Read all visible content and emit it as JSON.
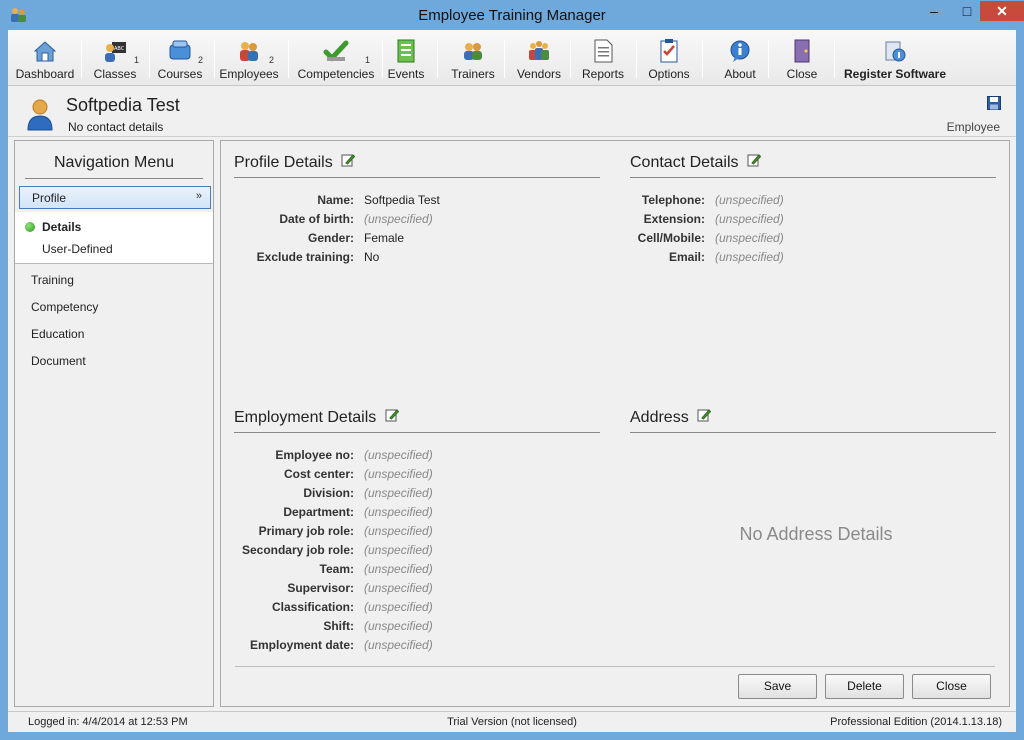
{
  "window": {
    "title": "Employee Training Manager",
    "minimize": "–",
    "maximize": "□",
    "close": "✕"
  },
  "toolbar": {
    "items": [
      {
        "label": "Dashboard",
        "count": "",
        "icon": "dashboard-icon"
      },
      {
        "label": "Classes",
        "count": "1",
        "icon": "classes-icon"
      },
      {
        "label": "Courses",
        "count": "2",
        "icon": "courses-icon"
      },
      {
        "label": "Employees",
        "count": "2",
        "icon": "employees-icon"
      },
      {
        "label": "Competencies",
        "count": "1",
        "icon": "competencies-icon"
      },
      {
        "label": "Events",
        "count": "",
        "icon": "events-icon"
      },
      {
        "label": "Trainers",
        "count": "",
        "icon": "trainers-icon"
      },
      {
        "label": "Vendors",
        "count": "",
        "icon": "vendors-icon"
      },
      {
        "label": "Reports",
        "count": "",
        "icon": "reports-icon"
      },
      {
        "label": "Options",
        "count": "",
        "icon": "options-icon"
      },
      {
        "label": "About",
        "count": "",
        "icon": "about-icon"
      },
      {
        "label": "Close",
        "count": "",
        "icon": "close-door-icon"
      },
      {
        "label": "Register Software",
        "count": "",
        "icon": "register-icon"
      }
    ]
  },
  "header": {
    "name": "Softpedia Test",
    "contact": "No contact details",
    "type": "Employee"
  },
  "nav": {
    "title": "Navigation Menu",
    "profile": "Profile",
    "chevron": "»",
    "details": "Details",
    "user_defined": "User-Defined",
    "items": [
      "Training",
      "Competency",
      "Education",
      "Document"
    ]
  },
  "profile": {
    "title": "Profile Details",
    "fields": [
      {
        "label": "Name:",
        "value": "Softpedia Test"
      },
      {
        "label": "Date of birth:",
        "value": "(unspecified)"
      },
      {
        "label": "Gender:",
        "value": "Female"
      },
      {
        "label": "Exclude training:",
        "value": "No"
      }
    ]
  },
  "contact": {
    "title": "Contact Details",
    "fields": [
      {
        "label": "Telephone:",
        "value": "(unspecified)"
      },
      {
        "label": "Extension:",
        "value": "(unspecified)"
      },
      {
        "label": "Cell/Mobile:",
        "value": "(unspecified)"
      },
      {
        "label": "Email:",
        "value": "(unspecified)"
      }
    ]
  },
  "employment": {
    "title": "Employment Details",
    "fields": [
      {
        "label": "Employee no:",
        "value": "(unspecified)"
      },
      {
        "label": "Cost center:",
        "value": "(unspecified)"
      },
      {
        "label": "Division:",
        "value": "(unspecified)"
      },
      {
        "label": "Department:",
        "value": "(unspecified)"
      },
      {
        "label": "Primary job role:",
        "value": "(unspecified)"
      },
      {
        "label": "Secondary job role:",
        "value": "(unspecified)"
      },
      {
        "label": "Team:",
        "value": "(unspecified)"
      },
      {
        "label": "Supervisor:",
        "value": "(unspecified)"
      },
      {
        "label": "Classification:",
        "value": "(unspecified)"
      },
      {
        "label": "Shift:",
        "value": "(unspecified)"
      },
      {
        "label": "Employment date:",
        "value": "(unspecified)"
      }
    ]
  },
  "address": {
    "title": "Address",
    "empty": "No Address Details"
  },
  "buttons": {
    "save": "Save",
    "delete": "Delete",
    "close": "Close"
  },
  "status": {
    "left": "Logged in:  4/4/2014 at 12:53 PM",
    "middle": "Trial Version (not licensed)",
    "right": "Professional Edition (2014.1.13.18)"
  }
}
